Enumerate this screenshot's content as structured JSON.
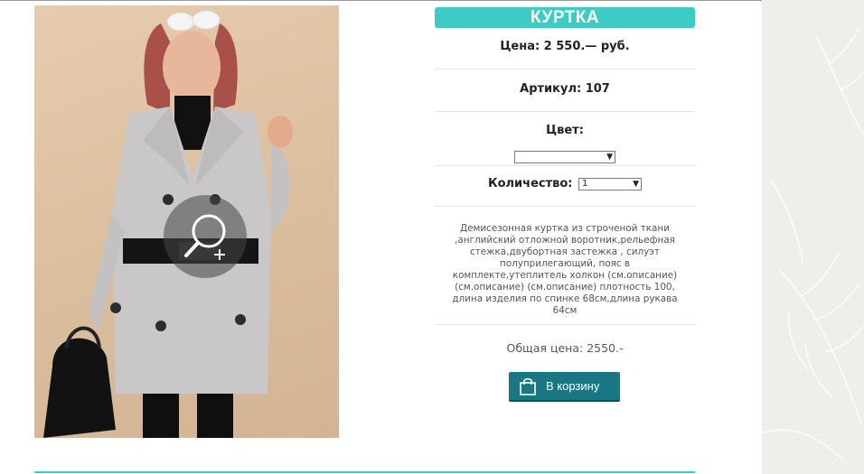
{
  "product": {
    "title": "КУРТКА",
    "price_text": "Цена: 2 550.— руб.",
    "sku_text": "Артикул: 107",
    "color_label": "Цвет:",
    "color_selected": "",
    "quantity_label": "Количество:",
    "quantity_selected": "1",
    "description": "Демисезонная куртка из строченой ткани ,английский отложной воротник,рельефная стежка,двубортная застежка , силуэт полуприлегающий, пояс в комплекте,утеплитель холкон (см.описание) (см.описание) (см.описание) плотность 100, длина изделия по спинке 68см,длина рукава 64см",
    "total_text": "Общая цена: 2550.-",
    "add_to_cart_label": "В корзину"
  },
  "icons": {
    "zoom": "zoom-in-icon",
    "cart": "shopping-bag-icon",
    "dropdown": "chevron-down-icon"
  },
  "colors": {
    "title_bar": "#3cccc4",
    "cart_button": "#1b7684",
    "bottom_rule": "#3cccc4"
  }
}
